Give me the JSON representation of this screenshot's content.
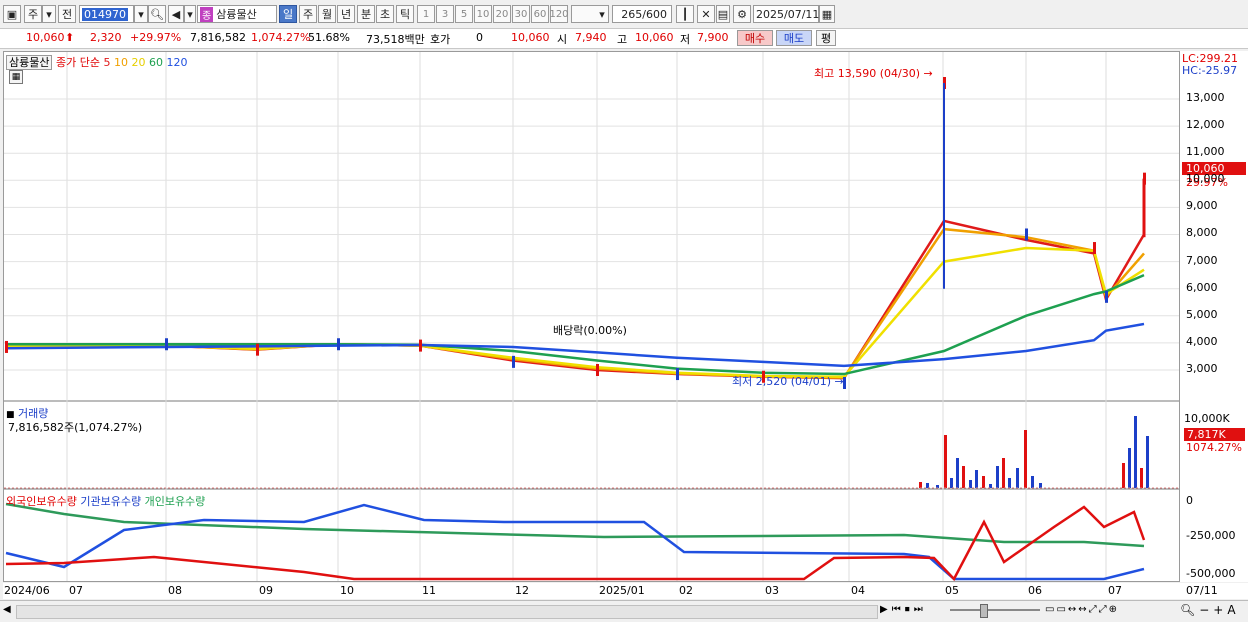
{
  "toolbar": {
    "period_label": "주",
    "prev_label": "전",
    "stock_code": "014970",
    "stock_name": "삼륭물산",
    "stock_badge": "종",
    "tabs": [
      "일",
      "주",
      "월",
      "년",
      "분",
      "초",
      "틱"
    ],
    "active_tab": "일",
    "intervals": [
      "1",
      "3",
      "5",
      "10",
      "20",
      "30",
      "60",
      "120"
    ],
    "count": "265",
    "count_total": "/600",
    "date": "2025/07/11"
  },
  "quote": {
    "price": "10,060",
    "change": "2,320",
    "change_pct": "+29.97%",
    "volume": "7,816,582",
    "volume_ratio": "1,074.27%",
    "turnover": "51.68%",
    "amount": "73,518백만",
    "ask_label": "호가",
    "ask_value": "0",
    "ask_price": "10,060",
    "open_label": "시",
    "open": "7,940",
    "high_label": "고",
    "high": "10,060",
    "low_label": "저",
    "low": "7,900",
    "buy_label": "매수",
    "sell_label": "매도",
    "eval_label": "평"
  },
  "price_panel": {
    "stock_name": "삼륭물산",
    "ma_title": "종가 단순",
    "ma_periods": [
      "5",
      "10",
      "20",
      "60",
      "120"
    ],
    "ma_colors": [
      "#e01a1a",
      "#f0a000",
      "#f0e000",
      "#1ea050",
      "#2050e0"
    ],
    "lc": "LC:299.21",
    "hc": "HC:-25.97",
    "current_price": "10,060",
    "current_pct": "29.97%",
    "high_annotation": "최고 13,590 (04/30)",
    "low_annotation": "최저 2,520 (04/01)",
    "dividend_annotation": "배당락(0.00%)",
    "y_ticks": [
      "13,000",
      "12,000",
      "11,000",
      "10,000",
      "9,000",
      "8,000",
      "7,000",
      "6,000",
      "5,000",
      "4,000",
      "3,000"
    ]
  },
  "volume_panel": {
    "title": "거래량",
    "value": "7,816,582주(1,074.27%)",
    "y_ticks": [
      "10,000K",
      "5,000K"
    ],
    "current": "7,817K",
    "current_pct": "1074.27%"
  },
  "holder_panel": {
    "series": [
      "외국인보유수량",
      "기관보유수량",
      "개인보유수량"
    ],
    "y_ticks": [
      "0",
      "-250,000",
      "-500,000"
    ]
  },
  "x_axis": [
    "2024/06",
    "07",
    "08",
    "09",
    "10",
    "11",
    "12",
    "2025/01",
    "02",
    "03",
    "04",
    "05",
    "06",
    "07",
    "07/11"
  ],
  "chart_data": {
    "type": "line",
    "title": "삼륭물산 (014970)",
    "x_range": [
      "2024/06",
      "2025/07/11"
    ],
    "price_ylim": [
      2520,
      13590
    ],
    "close_approx": [
      {
        "x": "2024/06",
        "y": 3850
      },
      {
        "x": "2024/08",
        "y": 3950
      },
      {
        "x": "2024/09",
        "y": 3750
      },
      {
        "x": "2024/10",
        "y": 3950
      },
      {
        "x": "2024/11",
        "y": 3900
      },
      {
        "x": "2024/12",
        "y": 3300
      },
      {
        "x": "2025/01",
        "y": 3000
      },
      {
        "x": "2025/02",
        "y": 2850
      },
      {
        "x": "2025/03",
        "y": 2750
      },
      {
        "x": "2025/04/01",
        "y": 2520
      },
      {
        "x": "2025/04/30",
        "y": 13590
      },
      {
        "x": "2025/05",
        "y": 8000
      },
      {
        "x": "2025/06",
        "y": 7500
      },
      {
        "x": "2025/07",
        "y": 5700
      },
      {
        "x": "2025/07/11",
        "y": 10060
      }
    ],
    "series": [
      {
        "name": "5",
        "values": [
          3850,
          3900,
          3750,
          3950,
          3900,
          3350,
          3000,
          2850,
          2750,
          2700,
          8500,
          7800,
          7300,
          5600,
          8000
        ]
      },
      {
        "name": "10",
        "values": [
          3860,
          3900,
          3760,
          3950,
          3900,
          3400,
          3050,
          2870,
          2760,
          2720,
          8200,
          7900,
          7400,
          5700,
          7300
        ]
      },
      {
        "name": "20",
        "values": [
          3870,
          3900,
          3780,
          3950,
          3900,
          3450,
          3100,
          2900,
          2780,
          2750,
          7000,
          7500,
          7400,
          5800,
          6700
        ]
      },
      {
        "name": "60",
        "values": [
          3950,
          3950,
          3950,
          3950,
          3930,
          3700,
          3350,
          3050,
          2900,
          2850,
          3700,
          5000,
          5800,
          5900,
          6500
        ]
      },
      {
        "name": "120",
        "values": [
          3800,
          3850,
          3870,
          3900,
          3920,
          3850,
          3650,
          3450,
          3300,
          3150,
          3400,
          3700,
          4100,
          4450,
          4700
        ]
      }
    ]
  }
}
